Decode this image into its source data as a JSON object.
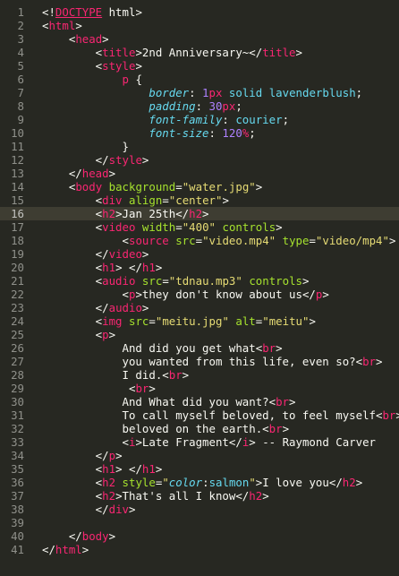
{
  "editor": {
    "active_line": 16,
    "lines": [
      {
        "n": "1",
        "tokens": [
          [
            "txt",
            "<!"
          ],
          [
            "d",
            "DOCTYPE"
          ],
          [
            "txt",
            " html>"
          ]
        ]
      },
      {
        "n": "2",
        "tokens": [
          [
            "txt",
            "<"
          ],
          [
            "t",
            "html"
          ],
          [
            "txt",
            ">"
          ]
        ]
      },
      {
        "n": "3",
        "tokens": [
          [
            "txt",
            "    <"
          ],
          [
            "t",
            "head"
          ],
          [
            "txt",
            ">"
          ]
        ]
      },
      {
        "n": "4",
        "tokens": [
          [
            "txt",
            "        <"
          ],
          [
            "t",
            "title"
          ],
          [
            "txt",
            ">2nd Anniversary~</"
          ],
          [
            "t",
            "title"
          ],
          [
            "txt",
            ">"
          ]
        ]
      },
      {
        "n": "5",
        "tokens": [
          [
            "txt",
            "        <"
          ],
          [
            "t",
            "style"
          ],
          [
            "txt",
            ">"
          ]
        ]
      },
      {
        "n": "6",
        "tokens": [
          [
            "txt",
            "            "
          ],
          [
            "t",
            "p"
          ],
          [
            "txt",
            " {"
          ]
        ]
      },
      {
        "n": "7",
        "tokens": [
          [
            "txt",
            "                "
          ],
          [
            "p",
            "border"
          ],
          [
            "txt",
            ": "
          ],
          [
            "n",
            "1"
          ],
          [
            "t",
            "px"
          ],
          [
            "txt",
            " "
          ],
          [
            "v",
            "solid"
          ],
          [
            "txt",
            " "
          ],
          [
            "v",
            "lavenderblush"
          ],
          [
            "txt",
            ";"
          ]
        ]
      },
      {
        "n": "8",
        "tokens": [
          [
            "txt",
            "                "
          ],
          [
            "p",
            "padding"
          ],
          [
            "txt",
            ": "
          ],
          [
            "n",
            "30"
          ],
          [
            "t",
            "px"
          ],
          [
            "txt",
            ";"
          ]
        ]
      },
      {
        "n": "9",
        "tokens": [
          [
            "txt",
            "                "
          ],
          [
            "p",
            "font-family"
          ],
          [
            "txt",
            ": "
          ],
          [
            "v",
            "courier"
          ],
          [
            "txt",
            ";"
          ]
        ]
      },
      {
        "n": "10",
        "tokens": [
          [
            "txt",
            "                "
          ],
          [
            "p",
            "font-size"
          ],
          [
            "txt",
            ": "
          ],
          [
            "n",
            "120"
          ],
          [
            "t",
            "%"
          ],
          [
            "txt",
            ";"
          ]
        ]
      },
      {
        "n": "11",
        "tokens": [
          [
            "txt",
            "            }"
          ]
        ]
      },
      {
        "n": "12",
        "tokens": [
          [
            "txt",
            "        </"
          ],
          [
            "t",
            "style"
          ],
          [
            "txt",
            ">"
          ]
        ]
      },
      {
        "n": "13",
        "tokens": [
          [
            "txt",
            "    </"
          ],
          [
            "t",
            "head"
          ],
          [
            "txt",
            ">"
          ]
        ]
      },
      {
        "n": "14",
        "tokens": [
          [
            "txt",
            "    <"
          ],
          [
            "t",
            "body"
          ],
          [
            "txt",
            " "
          ],
          [
            "a",
            "background"
          ],
          [
            "txt",
            "="
          ],
          [
            "s",
            "\"water.jpg\""
          ],
          [
            "txt",
            ">"
          ]
        ]
      },
      {
        "n": "15",
        "tokens": [
          [
            "txt",
            "        <"
          ],
          [
            "t",
            "div"
          ],
          [
            "txt",
            " "
          ],
          [
            "a",
            "align"
          ],
          [
            "txt",
            "="
          ],
          [
            "s",
            "\"center\""
          ],
          [
            "txt",
            ">"
          ]
        ]
      },
      {
        "n": "16",
        "tokens": [
          [
            "txt",
            "        <"
          ],
          [
            "t",
            "h2"
          ],
          [
            "txt",
            ">Jan 25th</"
          ],
          [
            "t",
            "h2"
          ],
          [
            "txt",
            ">"
          ]
        ]
      },
      {
        "n": "17",
        "tokens": [
          [
            "txt",
            "        <"
          ],
          [
            "t",
            "video"
          ],
          [
            "txt",
            " "
          ],
          [
            "a",
            "width"
          ],
          [
            "txt",
            "="
          ],
          [
            "s",
            "\"400\""
          ],
          [
            "txt",
            " "
          ],
          [
            "a",
            "controls"
          ],
          [
            "txt",
            ">"
          ]
        ]
      },
      {
        "n": "18",
        "tokens": [
          [
            "txt",
            "            <"
          ],
          [
            "t",
            "source"
          ],
          [
            "txt",
            " "
          ],
          [
            "a",
            "src"
          ],
          [
            "txt",
            "="
          ],
          [
            "s",
            "\"video.mp4\""
          ],
          [
            "txt",
            " "
          ],
          [
            "a",
            "type"
          ],
          [
            "txt",
            "="
          ],
          [
            "s",
            "\"video/mp4\""
          ],
          [
            "txt",
            ">"
          ]
        ]
      },
      {
        "n": "19",
        "tokens": [
          [
            "txt",
            "        </"
          ],
          [
            "t",
            "video"
          ],
          [
            "txt",
            ">"
          ]
        ]
      },
      {
        "n": "20",
        "tokens": [
          [
            "txt",
            "        <"
          ],
          [
            "t",
            "h1"
          ],
          [
            "txt",
            "> </"
          ],
          [
            "t",
            "h1"
          ],
          [
            "txt",
            ">"
          ]
        ]
      },
      {
        "n": "21",
        "tokens": [
          [
            "txt",
            "        <"
          ],
          [
            "t",
            "audio"
          ],
          [
            "txt",
            " "
          ],
          [
            "a",
            "src"
          ],
          [
            "txt",
            "="
          ],
          [
            "s",
            "\"tdnau.mp3\""
          ],
          [
            "txt",
            " "
          ],
          [
            "a",
            "controls"
          ],
          [
            "txt",
            ">"
          ]
        ]
      },
      {
        "n": "22",
        "tokens": [
          [
            "txt",
            "            <"
          ],
          [
            "t",
            "p"
          ],
          [
            "txt",
            ">they don't know about us</"
          ],
          [
            "t",
            "p"
          ],
          [
            "txt",
            ">"
          ]
        ]
      },
      {
        "n": "23",
        "tokens": [
          [
            "txt",
            "        </"
          ],
          [
            "t",
            "audio"
          ],
          [
            "txt",
            ">"
          ]
        ]
      },
      {
        "n": "24",
        "tokens": [
          [
            "txt",
            "        <"
          ],
          [
            "t",
            "img"
          ],
          [
            "txt",
            " "
          ],
          [
            "a",
            "src"
          ],
          [
            "txt",
            "="
          ],
          [
            "s",
            "\"meitu.jpg\""
          ],
          [
            "txt",
            " "
          ],
          [
            "a",
            "alt"
          ],
          [
            "txt",
            "="
          ],
          [
            "s",
            "\"meitu\""
          ],
          [
            "txt",
            ">"
          ]
        ]
      },
      {
        "n": "25",
        "tokens": [
          [
            "txt",
            "        <"
          ],
          [
            "t",
            "p"
          ],
          [
            "txt",
            ">"
          ]
        ]
      },
      {
        "n": "26",
        "tokens": [
          [
            "txt",
            "            And did you get what<"
          ],
          [
            "t",
            "br"
          ],
          [
            "txt",
            ">"
          ]
        ]
      },
      {
        "n": "27",
        "tokens": [
          [
            "txt",
            "            you wanted from this life, even so?<"
          ],
          [
            "t",
            "br"
          ],
          [
            "txt",
            ">"
          ]
        ]
      },
      {
        "n": "28",
        "tokens": [
          [
            "txt",
            "            I did.<"
          ],
          [
            "t",
            "br"
          ],
          [
            "txt",
            ">"
          ]
        ]
      },
      {
        "n": "29",
        "tokens": [
          [
            "txt",
            "             <"
          ],
          [
            "t",
            "br"
          ],
          [
            "txt",
            ">"
          ]
        ]
      },
      {
        "n": "30",
        "tokens": [
          [
            "txt",
            "            And What did you want?<"
          ],
          [
            "t",
            "br"
          ],
          [
            "txt",
            ">"
          ]
        ]
      },
      {
        "n": "31",
        "tokens": [
          [
            "txt",
            "            To call myself beloved, to feel myself<"
          ],
          [
            "t",
            "br"
          ],
          [
            "txt",
            ">"
          ]
        ]
      },
      {
        "n": "32",
        "tokens": [
          [
            "txt",
            "            beloved on the earth.<"
          ],
          [
            "t",
            "br"
          ],
          [
            "txt",
            ">"
          ]
        ]
      },
      {
        "n": "33",
        "tokens": [
          [
            "txt",
            "            <"
          ],
          [
            "t",
            "i"
          ],
          [
            "txt",
            ">Late Fragment</"
          ],
          [
            "t",
            "i"
          ],
          [
            "txt",
            "> -- Raymond Carver"
          ]
        ]
      },
      {
        "n": "34",
        "tokens": [
          [
            "txt",
            "        </"
          ],
          [
            "t",
            "p"
          ],
          [
            "txt",
            ">"
          ]
        ]
      },
      {
        "n": "35",
        "tokens": [
          [
            "txt",
            "        <"
          ],
          [
            "t",
            "h1"
          ],
          [
            "txt",
            "> </"
          ],
          [
            "t",
            "h1"
          ],
          [
            "txt",
            ">"
          ]
        ]
      },
      {
        "n": "36",
        "tokens": [
          [
            "txt",
            "        <"
          ],
          [
            "t",
            "h2"
          ],
          [
            "txt",
            " "
          ],
          [
            "a",
            "style"
          ],
          [
            "txt",
            "="
          ],
          [
            "s",
            "\""
          ],
          [
            "p",
            "color"
          ],
          [
            "txt",
            ":"
          ],
          [
            "v",
            "salmon"
          ],
          [
            "s",
            "\""
          ],
          [
            "txt",
            ">I love you</"
          ],
          [
            "t",
            "h2"
          ],
          [
            "txt",
            ">"
          ]
        ]
      },
      {
        "n": "37",
        "tokens": [
          [
            "txt",
            "        <"
          ],
          [
            "t",
            "h2"
          ],
          [
            "txt",
            ">That's all I know</"
          ],
          [
            "t",
            "h2"
          ],
          [
            "txt",
            ">"
          ]
        ]
      },
      {
        "n": "38",
        "tokens": [
          [
            "txt",
            "        </"
          ],
          [
            "t",
            "div"
          ],
          [
            "txt",
            ">"
          ]
        ]
      },
      {
        "n": "39",
        "tokens": [
          [
            "txt",
            ""
          ]
        ]
      },
      {
        "n": "40",
        "tokens": [
          [
            "txt",
            "    </"
          ],
          [
            "t",
            "body"
          ],
          [
            "txt",
            ">"
          ]
        ]
      },
      {
        "n": "41",
        "tokens": [
          [
            "txt",
            "</"
          ],
          [
            "t",
            "html"
          ],
          [
            "txt",
            ">"
          ]
        ]
      }
    ]
  }
}
